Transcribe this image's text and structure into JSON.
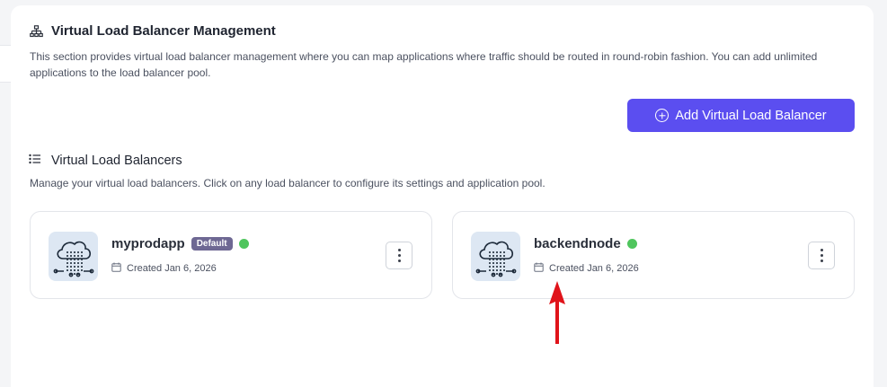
{
  "section": {
    "title": "Virtual Load Balancer Management",
    "description": "This section provides virtual load balancer management where you can map applications where traffic should be routed in round-robin fashion. You can add unlimited applications to the load balancer pool.",
    "icon": "sitemap-icon"
  },
  "add_button": {
    "label": "Add Virtual Load Balancer",
    "icon": "plus-circle-icon",
    "color": "#5b4ef0"
  },
  "list": {
    "title": "Virtual Load Balancers",
    "description": "Manage your virtual load balancers. Click on any load balancer to configure its settings and application pool.",
    "icon": "list-icon"
  },
  "balancers": [
    {
      "name": "myprodapp",
      "badge": "Default",
      "status": "active",
      "created": "Created Jan 6, 2026"
    },
    {
      "name": "backendnode",
      "badge": "",
      "status": "active",
      "created": "Created Jan 6, 2026"
    }
  ],
  "colors": {
    "status_active": "#4fc55d",
    "badge": "#6e6893",
    "annotation_arrow": "#e0131a"
  }
}
